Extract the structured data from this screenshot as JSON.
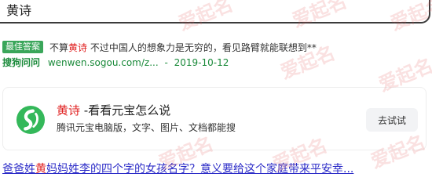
{
  "search": {
    "query": "黄诗"
  },
  "result1": {
    "badge": "最佳答案",
    "snippet_before": "不算",
    "snippet_hl": "黄诗",
    "snippet_after": " 不过中国人的想象力是无穷的，看见路臂就能联想到**",
    "source_name": "搜狗问问",
    "source_url": "wenwen.sogou.com/z...",
    "source_sep": "-",
    "source_date": "2019-10-12"
  },
  "card": {
    "title_hl": "黄诗",
    "title_rest": " -看看元宝怎么说",
    "desc": "腾讯元宝电脑版，文字、图片、文档都能搜",
    "button_label": "去试试",
    "logo_icon": "yuanbao-logo-icon",
    "logo_color": "#34b85a"
  },
  "next_result": {
    "title_before": "爸爸姓",
    "title_hl": "黄",
    "title_after": "妈妈姓李的四个字的女孩名字？意义要给这个家庭带来平安幸..."
  },
  "watermark": {
    "text": "爱起名"
  },
  "colors": {
    "highlight": "#e02020",
    "source_green": "#1a8a3a",
    "link_blue": "#2b2bc7",
    "badge_green": "#3aa65a"
  }
}
